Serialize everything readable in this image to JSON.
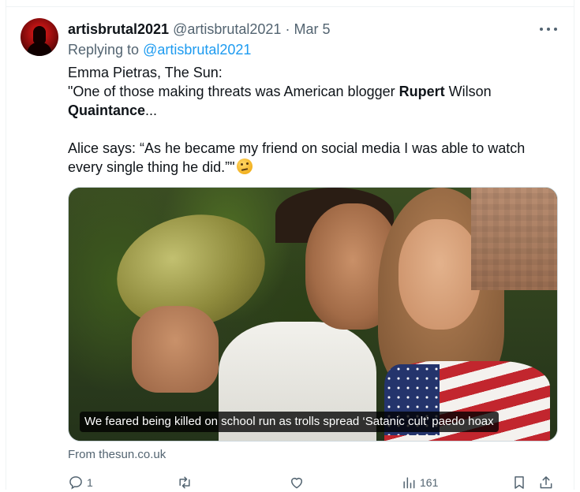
{
  "tweet": {
    "author": {
      "display_name": "artisbrutal2021",
      "handle": "@artisbrutal2021",
      "separator": "·",
      "date": "Mar 5"
    },
    "reply": {
      "prefix": "Replying to",
      "to": "@artisbrutal2021"
    },
    "text": {
      "line1": "Emma Pietras, The Sun:",
      "line2_a": "\"One of those making threats was American blogger ",
      "line2_b": "Rupert",
      "line2_c": " Wilson",
      "line3_a": "Quaintance",
      "line3_b": "...",
      "line4": "Alice says: “As he became my friend on social media I was able to watch",
      "line5": "every single thing he did.”\""
    },
    "media": {
      "caption": "We feared being killed on school run as trolls spread ‘Satanic cult’ paedo hoax"
    },
    "source": "From thesun.co.uk",
    "actions": {
      "reply_count": "1",
      "views_count": "161"
    }
  },
  "icons": {
    "more": "more-icon",
    "reply": "reply-icon",
    "retweet": "retweet-icon",
    "like": "like-icon",
    "views": "views-icon",
    "bookmark": "bookmark-icon",
    "share": "share-icon",
    "emoji": "thinking-face-icon"
  },
  "colors": {
    "link": "#1d9bf0",
    "secondary_text": "#536471",
    "primary_text": "#0f1419"
  }
}
